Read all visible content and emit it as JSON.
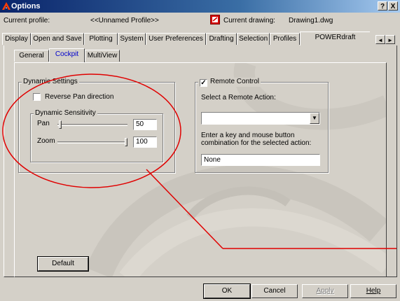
{
  "window": {
    "title": "Options",
    "help_button": "?",
    "close_button": "X"
  },
  "profile_bar": {
    "current_profile_label": "Current profile:",
    "current_profile_value": "<<Unnamed Profile>>",
    "current_drawing_label": "Current drawing:",
    "current_drawing_value": "Drawing1.dwg"
  },
  "main_tabs": [
    {
      "label": "Display"
    },
    {
      "label": "Open and Save"
    },
    {
      "label": "Plotting"
    },
    {
      "label": "System"
    },
    {
      "label": "User Preferences"
    },
    {
      "label": "Drafting"
    },
    {
      "label": "Selection"
    },
    {
      "label": "Profiles"
    },
    {
      "label": "POWERdraft",
      "active": true
    }
  ],
  "tab_scroll": {
    "left": "◄",
    "right": "►"
  },
  "sub_tabs": [
    {
      "label": "General"
    },
    {
      "label": "Cockpit",
      "active": true
    },
    {
      "label": "MultiView"
    }
  ],
  "dynamic_settings": {
    "legend": "Dynamic Settings",
    "reverse_pan_label": "Reverse Pan direction",
    "reverse_pan_checked": false,
    "sensitivity": {
      "legend": "Dynamic Sensitivity",
      "pan_label": "Pan",
      "pan_value": "50",
      "zoom_label": "Zoom",
      "zoom_value": "100"
    }
  },
  "remote_control": {
    "legend": "Remote Control",
    "enabled": true,
    "select_action_label": "Select a Remote Action:",
    "action_value": "",
    "key_label_line1": "Enter a key and mouse button",
    "key_label_line2": "combination for the selected action:",
    "key_value": "None"
  },
  "buttons": {
    "default": "Default",
    "ok": "OK",
    "cancel": "Cancel",
    "apply": "Apply",
    "help": "Help"
  },
  "annotation": {
    "color": "#e00000"
  }
}
